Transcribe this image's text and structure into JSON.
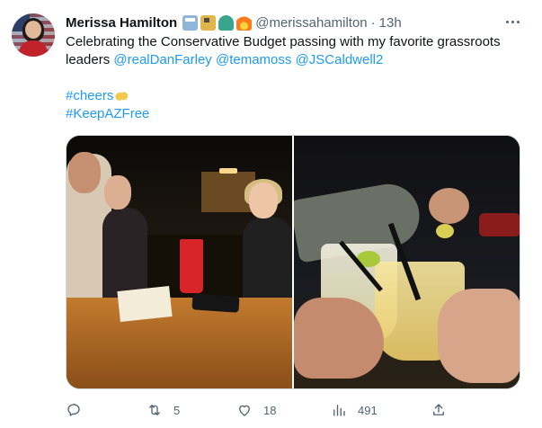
{
  "author": {
    "name": "Merissa Hamilton",
    "badge_icons": [
      "ballot-box-icon",
      "fuel-pump-icon",
      "statue-of-liberty-icon",
      "fire-icon"
    ],
    "handle": "@merissahamilton",
    "separator": "·",
    "time": "13h"
  },
  "tweet": {
    "text_line1": "Celebrating the Conservative Budget passing with my favorite grassroots",
    "text_line2_prefix": "leaders ",
    "mention1": "@realDanFarley",
    "mention2": "@temamoss",
    "mention3": "@JSCaldwell2",
    "hashtag1": "#cheers",
    "hashtag2": "#KeepAZFree"
  },
  "media": {
    "photos": [
      "group-at-table-photo",
      "drinks-toast-photo"
    ]
  },
  "actions": {
    "reply_count": "",
    "retweet_count": "5",
    "like_count": "18",
    "views_count": "491"
  },
  "colors": {
    "link": "#1d9bf0",
    "muted": "#536471",
    "text": "#0f1419"
  }
}
